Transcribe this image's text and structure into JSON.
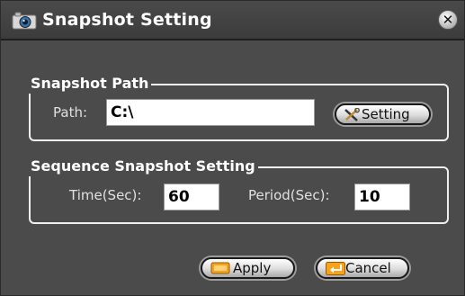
{
  "window": {
    "title": "Snapshot Setting",
    "close_icon": "close-icon",
    "camera_icon": "camera-icon"
  },
  "snapshot_path": {
    "legend": "Snapshot Path",
    "path_label": "Path:",
    "path_value": "C:\\",
    "setting_button": "Setting"
  },
  "sequence": {
    "legend": "Sequence Snapshot Setting",
    "time_label": "Time(Sec):",
    "time_value": "60",
    "period_label": "Period(Sec):",
    "period_value": "10"
  },
  "footer": {
    "apply_label": "Apply",
    "cancel_label": "Cancel"
  }
}
